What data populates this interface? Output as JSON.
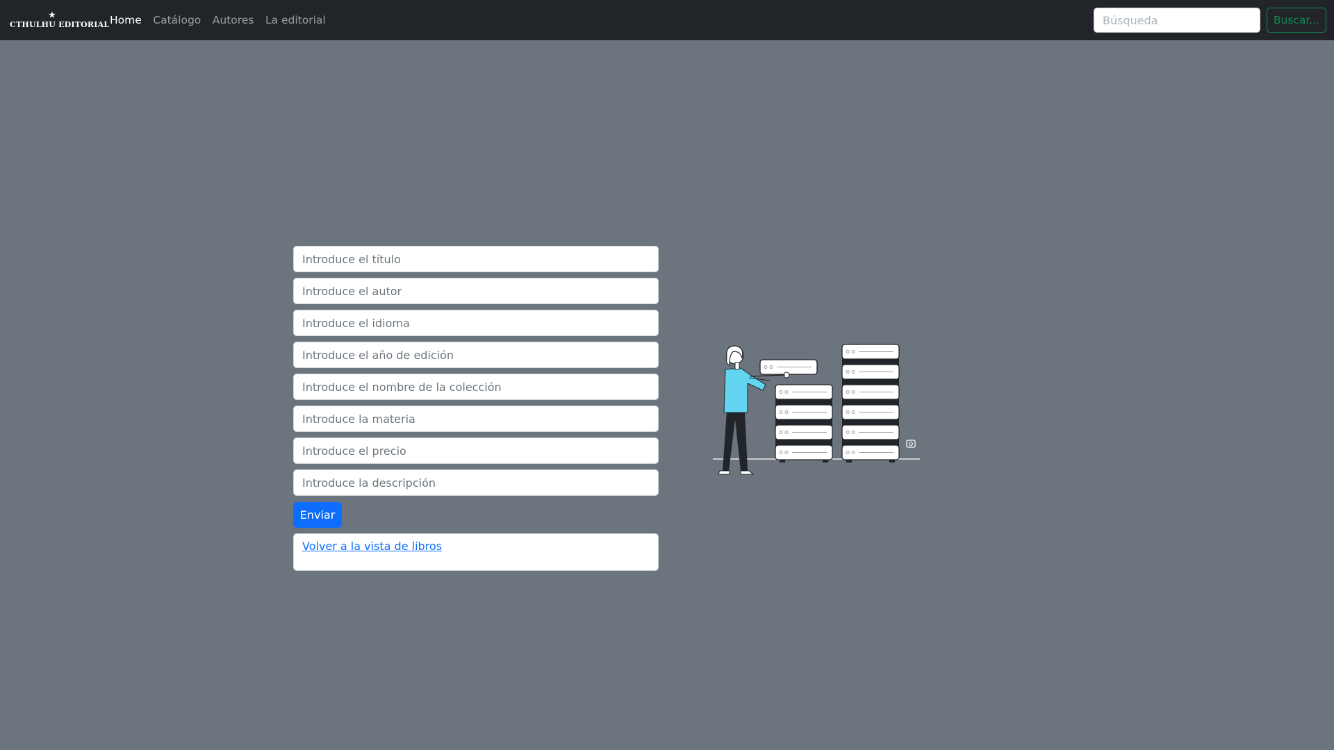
{
  "navbar": {
    "brand": "CTHULHU EDITORIAL",
    "brand_icon": "star-icon",
    "links": [
      {
        "label": "Home",
        "active": true
      },
      {
        "label": "Catálogo",
        "active": false
      },
      {
        "label": "Autores",
        "active": false
      },
      {
        "label": "La editorial",
        "active": false
      }
    ],
    "search": {
      "placeholder": "Búsqueda",
      "value": "",
      "button_label": "Buscar..."
    }
  },
  "form": {
    "fields": [
      {
        "placeholder": "Introduce el título",
        "value": ""
      },
      {
        "placeholder": "Introduce el autor",
        "value": ""
      },
      {
        "placeholder": "Introduce el idioma",
        "value": ""
      },
      {
        "placeholder": "Introduce el año de edición",
        "value": ""
      },
      {
        "placeholder": "Introduce el nombre de la colección",
        "value": ""
      },
      {
        "placeholder": "Introduce la materia",
        "value": ""
      },
      {
        "placeholder": "Introduce el precio",
        "value": ""
      },
      {
        "placeholder": "Introduce la descripción",
        "value": ""
      }
    ],
    "submit_label": "Enviar",
    "back_link": "Volver a la vista de libros"
  },
  "illustration": {
    "name": "person-server-racks-illustration",
    "accent_color": "#63d5f0"
  },
  "colors": {
    "page_background": "#6c757d",
    "navbar_background": "#212529",
    "primary": "#0d6efd",
    "success": "#198754"
  }
}
